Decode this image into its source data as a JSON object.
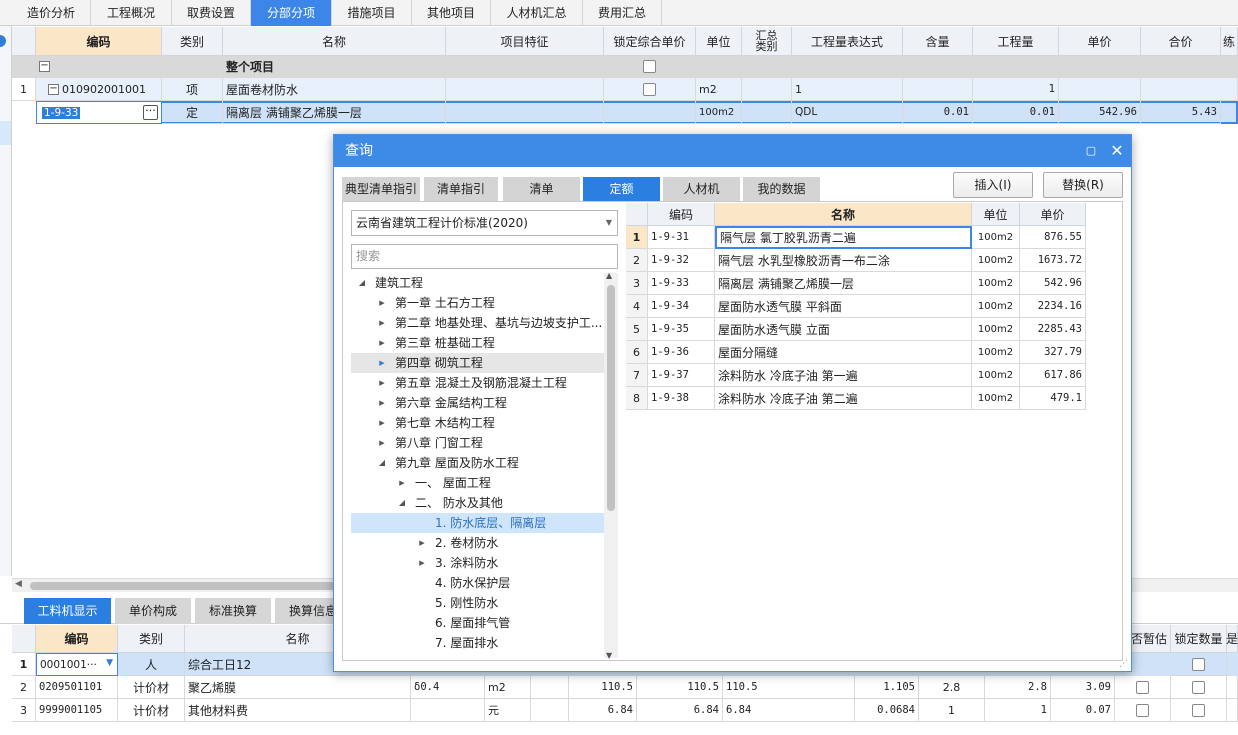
{
  "top_tabs": [
    "造价分析",
    "工程概况",
    "取费设置",
    "分部分项",
    "措施项目",
    "其他项目",
    "人材机汇总",
    "费用汇总"
  ],
  "main_grid": {
    "headers": [
      "编码",
      "类别",
      "名称",
      "项目特征",
      "锁定综合单价",
      "单位",
      "汇总类别",
      "工程量表达式",
      "含量",
      "工程量",
      "单价",
      "合价"
    ],
    "group_row": {
      "name": "整个项目"
    },
    "rows": [
      {
        "row_no": "1",
        "code": "010902001001",
        "type": "项",
        "name": "屋面卷材防水",
        "unit": "m2",
        "expr": "1",
        "qty": "1"
      },
      {
        "row_no": "",
        "code": "1-9-33",
        "type": "定",
        "name": "隔离层 满铺聚乙烯膜一层",
        "unit": "100m2",
        "expr": "QDL",
        "content": "0.01",
        "qty": "0.01",
        "price": "542.96",
        "total": "5.43"
      }
    ]
  },
  "dialog": {
    "title": "查询",
    "tabs": [
      "典型清单指引",
      "清单指引",
      "清单",
      "定额",
      "人材机",
      "我的数据"
    ],
    "active_tab": "定额",
    "insert_label": "插入(I)",
    "replace_label": "替换(R)",
    "standard": "云南省建筑工程计价标准(2020)",
    "search_placeholder": "搜索",
    "tree": [
      {
        "label": "建筑工程",
        "level": 0,
        "state": "open"
      },
      {
        "label": "第一章 土石方工程",
        "level": 1,
        "state": "closed"
      },
      {
        "label": "第二章 地基处理、基坑与边坡支护工...",
        "level": 1,
        "state": "closed"
      },
      {
        "label": "第三章 桩基础工程",
        "level": 1,
        "state": "closed"
      },
      {
        "label": "第四章 砌筑工程",
        "level": 1,
        "state": "closed-hover"
      },
      {
        "label": "第五章 混凝土及钢筋混凝土工程",
        "level": 1,
        "state": "closed"
      },
      {
        "label": "第六章 金属结构工程",
        "level": 1,
        "state": "closed"
      },
      {
        "label": "第七章 木结构工程",
        "level": 1,
        "state": "closed"
      },
      {
        "label": "第八章 门窗工程",
        "level": 1,
        "state": "closed"
      },
      {
        "label": "第九章 屋面及防水工程",
        "level": 1,
        "state": "open"
      },
      {
        "label": "一、 屋面工程",
        "level": 2,
        "state": "closed"
      },
      {
        "label": "二、 防水及其他",
        "level": 2,
        "state": "open"
      },
      {
        "label": "1. 防水底层、隔离层",
        "level": 3,
        "state": "selected"
      },
      {
        "label": "2. 卷材防水",
        "level": 3,
        "state": "closed"
      },
      {
        "label": "3. 涂料防水",
        "level": 3,
        "state": "closed"
      },
      {
        "label": "4. 防水保护层",
        "level": 3,
        "state": "leaf"
      },
      {
        "label": "5. 刚性防水",
        "level": 3,
        "state": "leaf"
      },
      {
        "label": "6. 屋面排气管",
        "level": 3,
        "state": "leaf"
      },
      {
        "label": "7. 屋面排水",
        "level": 3,
        "state": "leaf"
      }
    ],
    "grid_headers": [
      "编码",
      "名称",
      "单位",
      "单价"
    ],
    "grid_rows": [
      {
        "n": "1",
        "code": "1-9-31",
        "name": "隔气层 氯丁胶乳沥青二遍",
        "unit": "100m2",
        "price": "876.55"
      },
      {
        "n": "2",
        "code": "1-9-32",
        "name": "隔气层 水乳型橡胶沥青一布二涂",
        "unit": "100m2",
        "price": "1673.72"
      },
      {
        "n": "3",
        "code": "1-9-33",
        "name": "隔离层 满铺聚乙烯膜一层",
        "unit": "100m2",
        "price": "542.96"
      },
      {
        "n": "4",
        "code": "1-9-34",
        "name": "屋面防水透气膜 平斜面",
        "unit": "100m2",
        "price": "2234.16"
      },
      {
        "n": "5",
        "code": "1-9-35",
        "name": "屋面防水透气膜 立面",
        "unit": "100m2",
        "price": "2285.43"
      },
      {
        "n": "6",
        "code": "1-9-36",
        "name": "屋面分隔缝",
        "unit": "100m2",
        "price": "327.79"
      },
      {
        "n": "7",
        "code": "1-9-37",
        "name": "涂料防水 冷底子油 第一遍",
        "unit": "100m2",
        "price": "617.86"
      },
      {
        "n": "8",
        "code": "1-9-38",
        "name": "涂料防水 冷底子油 第二遍",
        "unit": "100m2",
        "price": "479.1"
      }
    ]
  },
  "bottom_tabs": [
    "工料机显示",
    "单价构成",
    "标准换算",
    "换算信息"
  ],
  "bottom_grid": {
    "headers": [
      "编码",
      "类别",
      "名称",
      "否暂估",
      "锁定数量"
    ],
    "rows": [
      {
        "n": "1",
        "code": "0001001···",
        "type": "人",
        "name": "综合工日12"
      },
      {
        "n": "2",
        "code": "0209501101",
        "type": "计价材",
        "name": "聚乙烯膜",
        "spec": "δ0.4",
        "unit": "m2",
        "v1": "110.5",
        "v2": "110.5",
        "v3": "110.5",
        "v4": "1.105",
        "v5": "2.8",
        "v6": "2.8",
        "v7": "3.09"
      },
      {
        "n": "3",
        "code": "9999001105",
        "type": "计价材",
        "name": "其他材料费",
        "spec": "",
        "unit": "元",
        "v1": "6.84",
        "v2": "6.84",
        "v3": "6.84",
        "v4": "0.0684",
        "v5": "1",
        "v6": "1",
        "v7": "0.07"
      }
    ]
  }
}
